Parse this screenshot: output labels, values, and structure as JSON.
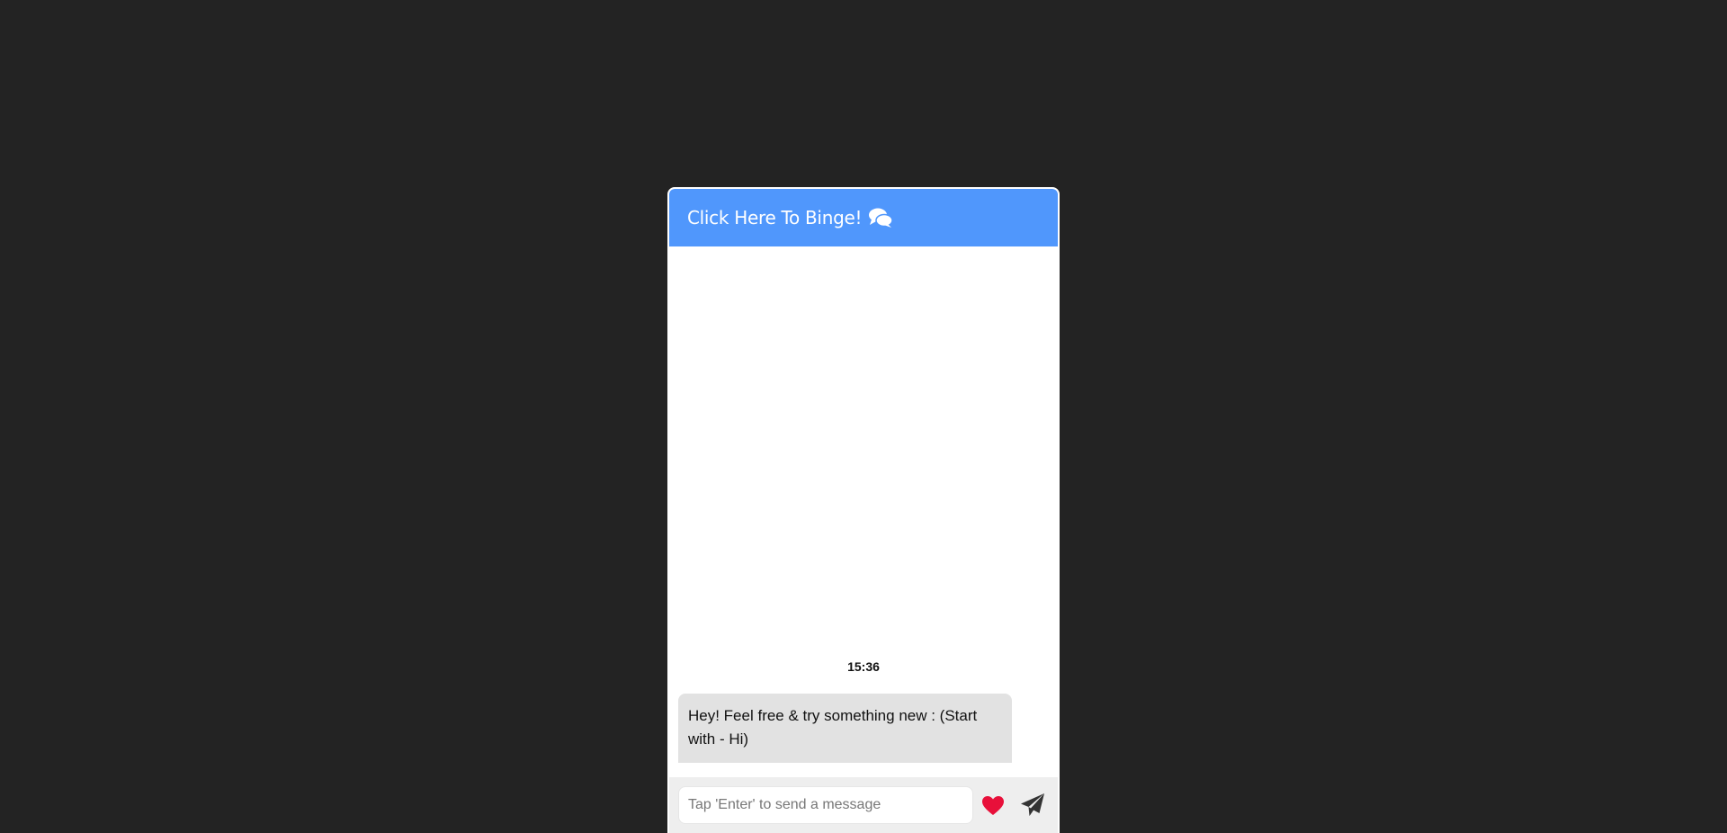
{
  "header": {
    "title": "Click Here To Binge!",
    "icon": "comments-icon",
    "background_color": "#5097fc"
  },
  "messages": [
    {
      "time": "15:36",
      "text": "Hey! Feel free & try something new : (Start with - Hi)"
    }
  ],
  "input": {
    "placeholder": "Tap 'Enter' to send a message",
    "value": ""
  },
  "actions": {
    "heart_icon": "heart-icon",
    "heart_color": "#e8103a",
    "send_icon": "paper-plane-icon"
  },
  "colors": {
    "page_background": "#232323",
    "bubble_background": "#e2e2e2",
    "input_bar_background": "#eeeeee"
  }
}
